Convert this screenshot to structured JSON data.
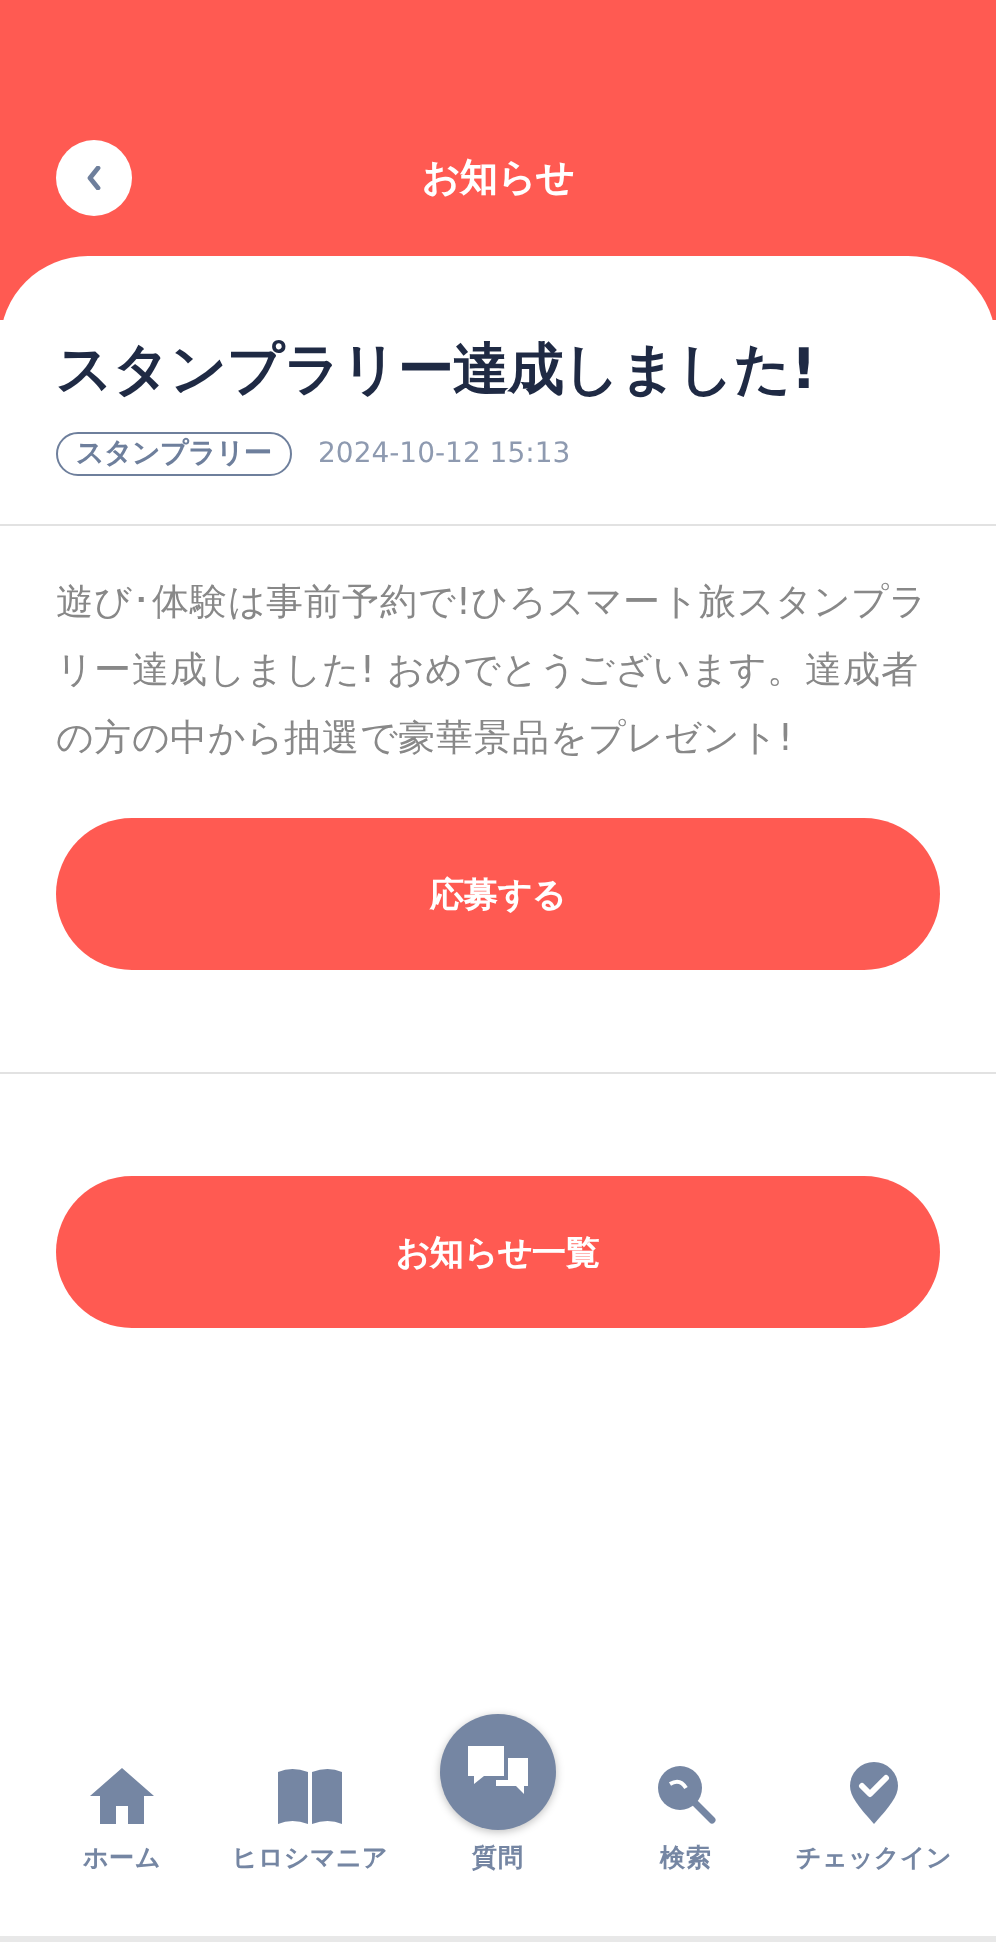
{
  "header": {
    "title": "お知らせ"
  },
  "notice": {
    "title": "スタンプラリー達成しました!",
    "tag": "スタンプラリー",
    "date": "2024-10-12 15:13",
    "body": "遊び･体験は事前予約で!ひろスマート旅スタンプラリー達成しました! おめでとうございます。達成者の方の中から抽選で豪華景品をプレゼント!",
    "action": "応募する"
  },
  "list_button": "お知らせ一覧",
  "nav": [
    {
      "kind": "home",
      "label": "ホーム"
    },
    {
      "kind": "book",
      "label": "ヒロシマニア"
    },
    {
      "kind": "question",
      "label": "質問"
    },
    {
      "kind": "search",
      "label": "検索"
    },
    {
      "kind": "checkin",
      "label": "チェックイン"
    }
  ]
}
